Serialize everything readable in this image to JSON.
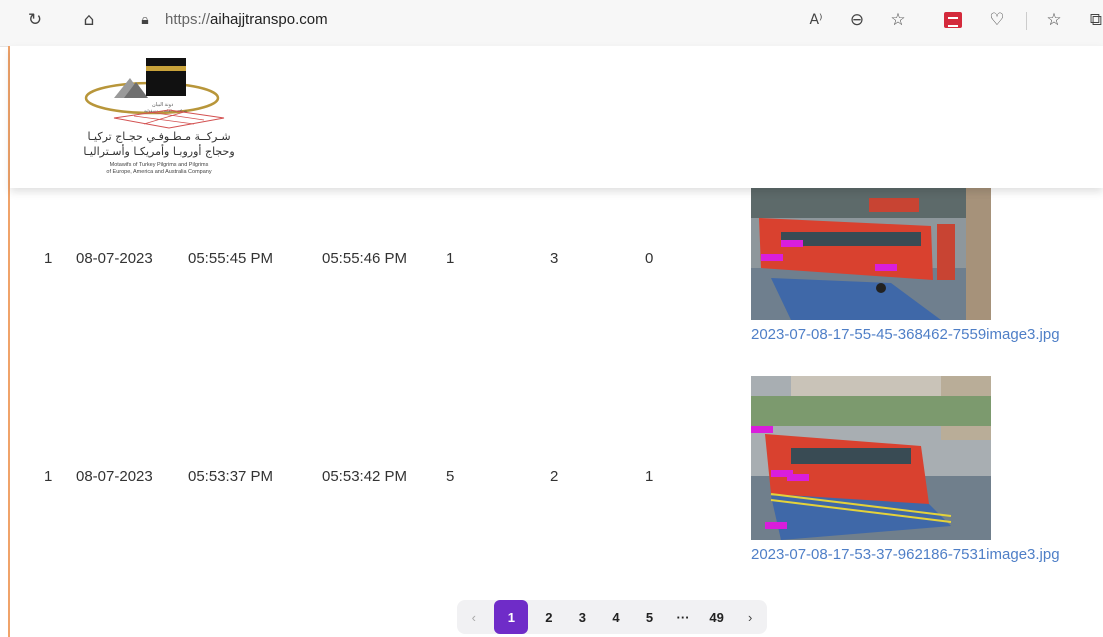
{
  "browser": {
    "url_prefix": "https://",
    "url_domain": "aihajjtranspo.com",
    "icons": [
      "refresh-icon",
      "home-icon",
      "lock-icon",
      "read-aloud-icon",
      "zoom-icon",
      "favorite-icon",
      "extension-icon",
      "browser-essentials-icon",
      "favorites-list-icon",
      "collections-icon"
    ]
  },
  "header": {
    "logo_ar_line1": "شـركــة مـطـوفـي حجـاج تركيـا",
    "logo_ar_line2": "وحجاج أوروبـا وأمريكـا وأسـتراليـا",
    "logo_en_line1": "Motawifs of Turkey Pilgrims and Pilgrims",
    "logo_en_line2": "of Europe, America and Australia Company"
  },
  "rows": [
    {
      "id": "1",
      "date": "08-07-2023",
      "start": "05:55:45 PM",
      "end": "05:55:46 PM",
      "c1": "1",
      "c2": "3",
      "c3": "0",
      "image_name": "2023-07-08-17-55-45-368462-7559image3.jpg"
    },
    {
      "id": "1",
      "date": "08-07-2023",
      "start": "05:53:37 PM",
      "end": "05:53:42 PM",
      "c1": "5",
      "c2": "2",
      "c3": "1",
      "image_name": "2023-07-08-17-53-37-962186-7531image3.jpg"
    }
  ],
  "pagination": {
    "prev": "‹",
    "pages": [
      "1",
      "2",
      "3",
      "4",
      "5"
    ],
    "ellipsis": "···",
    "last": "49",
    "next": "›",
    "current": "1"
  },
  "colors": {
    "accent": "#6f2cc8",
    "link": "#4f7fc7",
    "bus_red": "#d9412f",
    "frame_orange": "#f0a36a"
  }
}
